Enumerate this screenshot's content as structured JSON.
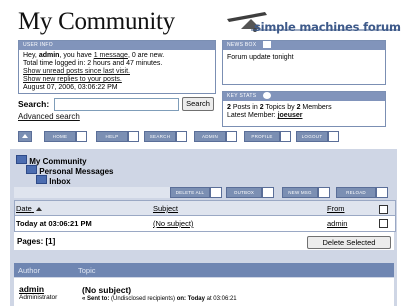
{
  "forum": {
    "title": "My Community",
    "logo_text": "simple machines forum"
  },
  "user_info": {
    "title": "USER INFO",
    "greeting_prefix": "Hey, ",
    "username": "admin",
    "greeting_mid": ", you have ",
    "messages_link": "1 message",
    "greeting_suffix": ", 0 are new.",
    "time_logged": "Total time logged in: 2 hours and 47 minutes.",
    "unread_link": "Show unread posts since last visit.",
    "replies_link": "Show new replies to your posts.",
    "datetime": "August 07, 2006, 03:06:22 PM"
  },
  "news_box": {
    "title": "NEWS BOX",
    "text": "Forum update tonight"
  },
  "key_stats": {
    "title": "KEY STATS",
    "posts_num": "2",
    "posts_mid": " Posts in ",
    "topics_num": "2",
    "topics_mid": " Topics by ",
    "members_num": "2",
    "members_suffix": " Members",
    "latest_label": "Latest Member: ",
    "latest_member": "joeuser"
  },
  "search": {
    "label": "Search:",
    "value": "",
    "button": "Search",
    "advanced": "Advanced search"
  },
  "nav": [
    "HOME",
    "HELP",
    "SEARCH",
    "ADMIN",
    "PROFILE",
    "LOGOUT"
  ],
  "breadcrumb": [
    "My Community",
    "Personal Messages",
    "Inbox"
  ],
  "toolbar": [
    "DELETE ALL",
    "OUTBOX",
    "NEW MSG",
    "RELOAD"
  ],
  "inbox": {
    "col_date": "Date",
    "col_subject": "Subject",
    "col_from": "From",
    "rows": [
      {
        "date": "Today at 03:06:21 PM",
        "subject": "(No subject)",
        "from": "admin"
      }
    ],
    "pages_label": "Pages: ",
    "pages_value": "[1]",
    "delete_button": "Delete Selected"
  },
  "message": {
    "col_author": "Author",
    "col_topic": "Topic",
    "author": "admin",
    "role": "Administrator",
    "subject": "(No subject)",
    "meta_prefix": "« Sent to: ",
    "meta_recipients": "(Undisclosed recipients)",
    "meta_on": " on: ",
    "meta_today": "Today",
    "meta_time": " at 03:06:21"
  },
  "colors": {
    "accent": "#7b8fb3",
    "header_bar": "#8194bb",
    "lower_bg": "#cfd6e5"
  }
}
